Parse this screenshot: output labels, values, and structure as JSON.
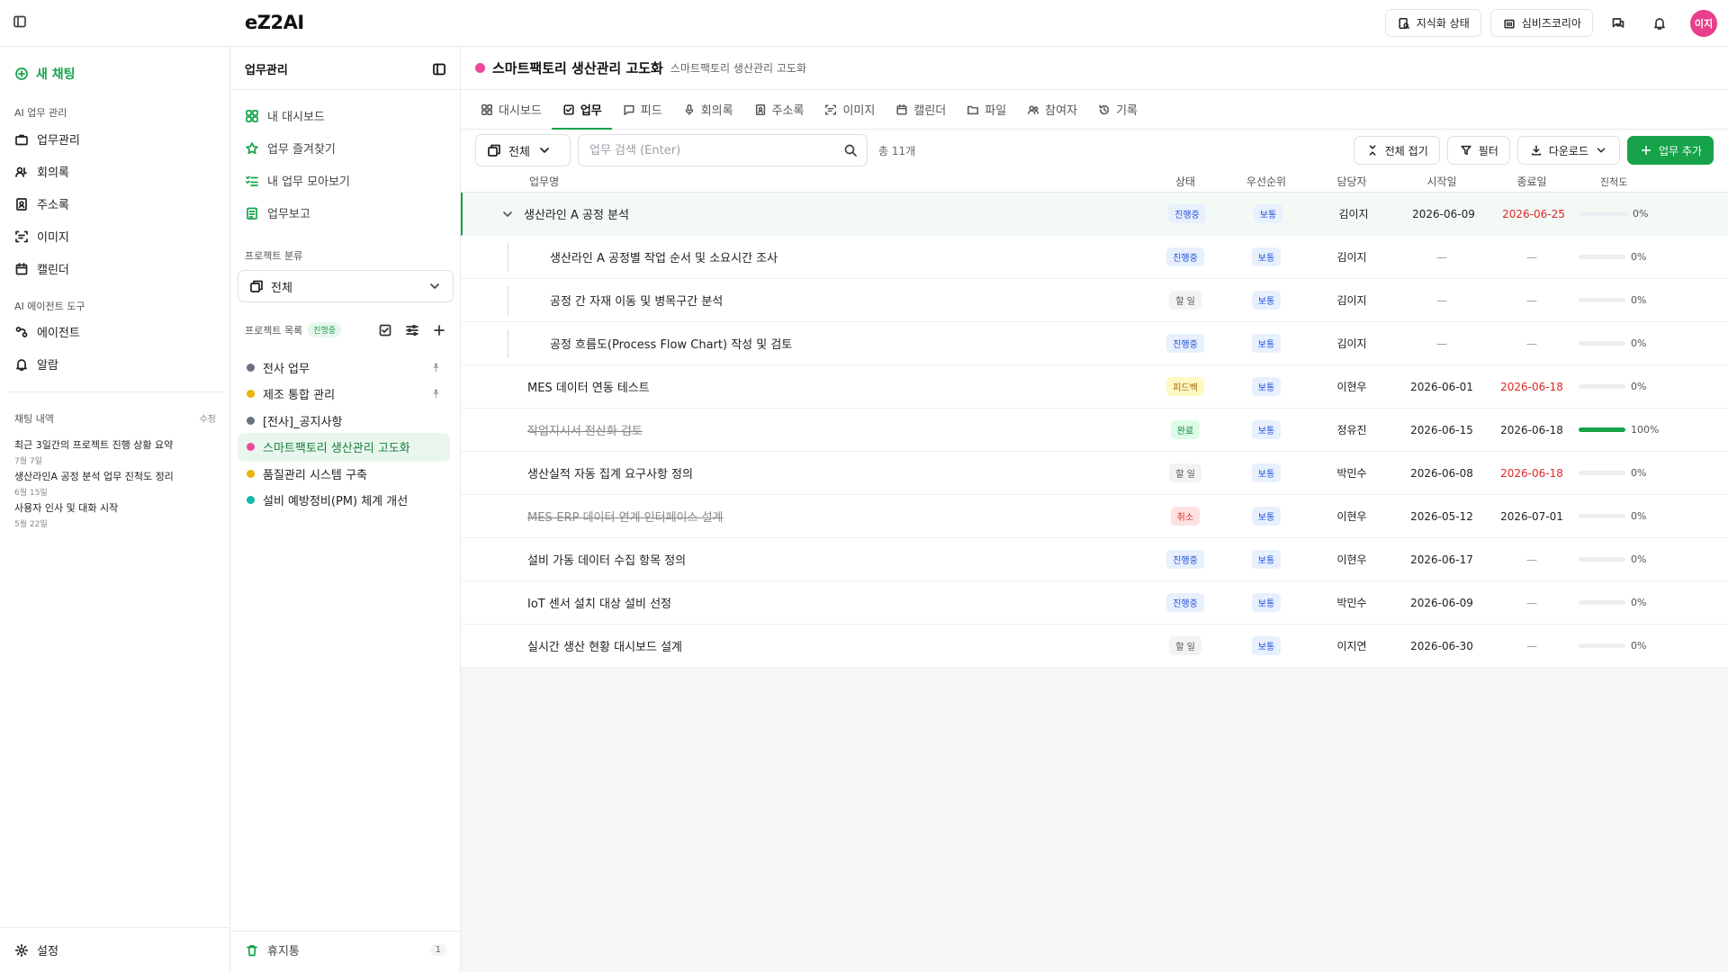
{
  "app": {
    "logo": "eZ2AI"
  },
  "topbar": {
    "knowledge_status": "지식화 상태",
    "org_name": "심비즈코리아",
    "avatar_text": "이지"
  },
  "sidebar": {
    "new_chat": "새 채팅",
    "section_ai_work": "AI 업무 관리",
    "items": [
      {
        "label": "업무관리",
        "icon": "briefcase-icon"
      },
      {
        "label": "회의록",
        "icon": "meeting-icon"
      },
      {
        "label": "주소록",
        "icon": "contact-book-icon"
      },
      {
        "label": "이미지",
        "icon": "image-scan-icon"
      },
      {
        "label": "캘린더",
        "icon": "calendar-icon"
      }
    ],
    "section_agent": "AI 에이전트 도구",
    "agent_items": [
      {
        "label": "에이전트",
        "icon": "agent-icon"
      },
      {
        "label": "알람",
        "icon": "bell-icon"
      }
    ],
    "chat_history_title": "채팅 내역",
    "chat_history_edit": "수정",
    "chat_history": [
      {
        "title": "최근 3일간의 프로젝트 진행 상황 요약",
        "date": "7월 7일"
      },
      {
        "title": "생산라인A 공정 분석 업무 진척도 정리",
        "date": "6월 15일"
      },
      {
        "title": "사용자 인사 및 대화 시작",
        "date": "5월 22일"
      }
    ],
    "settings": "설정"
  },
  "panel": {
    "title": "업무관리",
    "links": [
      {
        "label": "내 대시보드",
        "icon": "dashboard-icon"
      },
      {
        "label": "업무 즐겨찾기",
        "icon": "star-icon"
      },
      {
        "label": "내 업무 모아보기",
        "icon": "checklist-icon"
      },
      {
        "label": "업무보고",
        "icon": "report-icon"
      }
    ],
    "category_label": "프로젝트 분류",
    "category_value": "전체",
    "project_list_label": "프로젝트 목록",
    "project_list_badge": "진행중",
    "projects": [
      {
        "name": "전사 업무",
        "color": "#6b7280",
        "pinned": true
      },
      {
        "name": "제조 통합 관리",
        "color": "#eab308",
        "pinned": true
      },
      {
        "name": "[전사]_공지사항",
        "color": "#6b7280",
        "pinned": false
      },
      {
        "name": "스마트팩토리 생산관리 고도화",
        "color": "#ec4899",
        "pinned": false,
        "active": true
      },
      {
        "name": "품질관리 시스템 구축",
        "color": "#eab308",
        "pinned": false
      },
      {
        "name": "설비 예방정비(PM) 체계 개선",
        "color": "#14b8a6",
        "pinned": false
      }
    ],
    "trash_label": "휴지통",
    "trash_count": "1"
  },
  "main": {
    "title": "스마트팩토리 생산관리 고도화",
    "subtitle": "스마트팩토리 생산관리 고도화",
    "title_dot_color": "#ec4899",
    "tabs": [
      {
        "label": "대시보드",
        "icon": "dashboard-icon"
      },
      {
        "label": "업무",
        "icon": "task-check-icon",
        "active": true
      },
      {
        "label": "피드",
        "icon": "chat-bubble-icon"
      },
      {
        "label": "회의록",
        "icon": "microphone-icon"
      },
      {
        "label": "주소록",
        "icon": "contact-book-icon"
      },
      {
        "label": "이미지",
        "icon": "image-scan-icon"
      },
      {
        "label": "캘린더",
        "icon": "calendar-icon"
      },
      {
        "label": "파일",
        "icon": "folder-icon"
      },
      {
        "label": "참여자",
        "icon": "people-icon"
      },
      {
        "label": "기록",
        "icon": "history-icon"
      }
    ],
    "toolbar": {
      "scope": "전체",
      "search_placeholder": "업무 검색 (Enter)",
      "total": "총 11개",
      "collapse_all": "전체 접기",
      "filter": "필터",
      "download": "다운로드",
      "add_task": "업무 추가"
    },
    "columns": {
      "name": "업무명",
      "status": "상태",
      "priority": "우선순위",
      "owner": "담당자",
      "start": "시작일",
      "end": "종료일",
      "progress": "진척도"
    },
    "tasks": [
      {
        "name": "생산라인 A 공정 분석",
        "level": 0,
        "expandable": true,
        "selected": true,
        "status": "진행중",
        "priority": "보통",
        "owner": "김이지",
        "start": "2026-06-09",
        "end": "2026-06-25",
        "end_overdue": true,
        "progress": 0,
        "progress_label": "0%"
      },
      {
        "name": "생산라인 A 공정별 작업 순서 및 소요시간 조사",
        "level": 1,
        "status": "진행중",
        "priority": "보통",
        "owner": "김이지",
        "start": "—",
        "end": "—",
        "progress": 0,
        "progress_label": "0%"
      },
      {
        "name": "공정 간 자재 이동 및 병목구간 분석",
        "level": 1,
        "status": "할 일",
        "priority": "보통",
        "owner": "김이지",
        "start": "—",
        "end": "—",
        "progress": 0,
        "progress_label": "0%"
      },
      {
        "name": "공정 흐름도(Process Flow Chart) 작성 및 검토",
        "level": 1,
        "status": "진행중",
        "priority": "보통",
        "owner": "김이지",
        "start": "—",
        "end": "—",
        "progress": 0,
        "progress_label": "0%"
      },
      {
        "name": "MES 데이터 연동 테스트",
        "level": 0,
        "status": "피드백",
        "priority": "보통",
        "owner": "이현우",
        "start": "2026-06-01",
        "end": "2026-06-18",
        "end_overdue": true,
        "progress": 0,
        "progress_label": "0%"
      },
      {
        "name": "작업지시서 전산화 검토",
        "level": 0,
        "strike": true,
        "status": "완료",
        "priority": "보통",
        "owner": "정유진",
        "start": "2026-06-15",
        "end": "2026-06-18",
        "progress": 100,
        "progress_label": "100%"
      },
      {
        "name": "생산실적 자동 집계 요구사항 정의",
        "level": 0,
        "status": "할 일",
        "priority": "보통",
        "owner": "박민수",
        "start": "2026-06-08",
        "end": "2026-06-18",
        "end_overdue": true,
        "progress": 0,
        "progress_label": "0%"
      },
      {
        "name": "MES-ERP 데이터 연계 인터페이스 설계",
        "level": 0,
        "strike": true,
        "status": "취소",
        "priority": "보통",
        "owner": "이현우",
        "start": "2026-05-12",
        "end": "2026-07-01",
        "progress": 0,
        "progress_label": "0%"
      },
      {
        "name": "설비 가동 데이터 수집 항목 정의",
        "level": 0,
        "status": "진행중",
        "priority": "보통",
        "owner": "이현우",
        "start": "2026-06-17",
        "end": "—",
        "progress": 0,
        "progress_label": "0%"
      },
      {
        "name": "IoT 센서 설치 대상 설비 선정",
        "level": 0,
        "status": "진행중",
        "priority": "보통",
        "owner": "박민수",
        "start": "2026-06-09",
        "end": "—",
        "progress": 0,
        "progress_label": "0%"
      },
      {
        "name": "실시간 생산 현황 대시보드 설계",
        "level": 0,
        "status": "할 일",
        "priority": "보통",
        "owner": "이지연",
        "start": "2026-06-30",
        "end": "—",
        "progress": 0,
        "progress_label": "0%"
      }
    ],
    "status_colors": {
      "진행중": {
        "bg": "#e8f0fe",
        "fg": "#1d4ed8"
      },
      "할 일": {
        "bg": "#f1f3f5",
        "fg": "#555555"
      },
      "피드백": {
        "bg": "#fef9c3",
        "fg": "#a16207"
      },
      "완료": {
        "bg": "#dcfce7",
        "fg": "#15803d"
      },
      "취소": {
        "bg": "#fee2e2",
        "fg": "#dc2626"
      }
    }
  }
}
